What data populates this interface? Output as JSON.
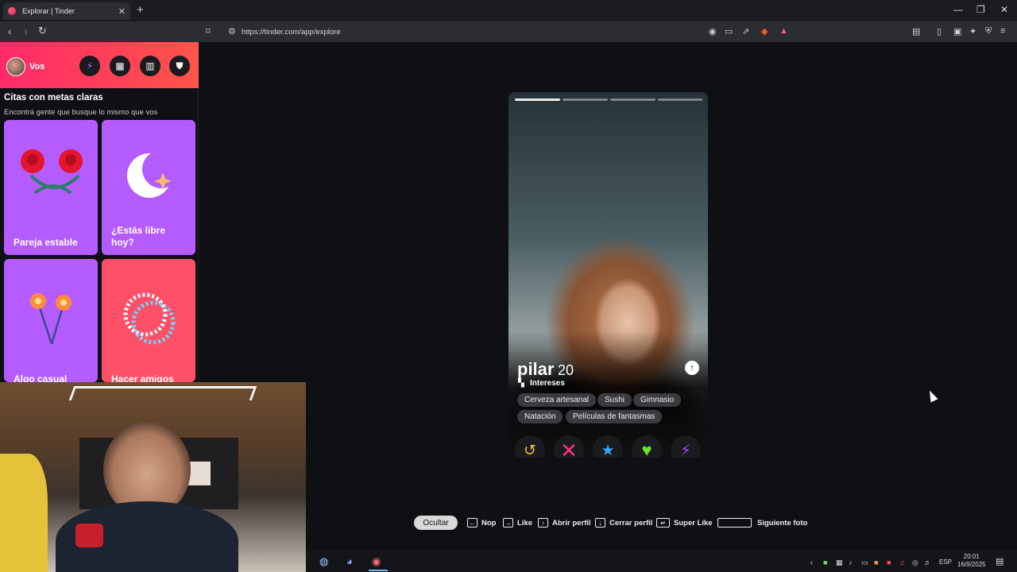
{
  "browser": {
    "tab_title": "Explorar | Tinder",
    "url": "https://tinder.com/app/explore",
    "new_tab": "+",
    "close": "✕"
  },
  "sidebar": {
    "user_label": "Vos",
    "section_title": "Citas con metas claras",
    "section_subtitle": "Encontrá gente que busque lo mismo que vos",
    "cards": [
      {
        "label": "Pareja estable",
        "bg": "#b45cff"
      },
      {
        "label": "¿Estás libre hoy?",
        "bg": "#b45cff"
      },
      {
        "label": "Algo casual",
        "bg": "#b45cff"
      },
      {
        "label": "Hacer amigos",
        "bg": "#ff5067"
      }
    ]
  },
  "profile": {
    "name": "pilar",
    "age": "20",
    "interests_label": "Intereses",
    "interests": [
      "Cerveza artesanal",
      "Sushi",
      "Gimnasio",
      "Natación",
      "Películas de fantasmas"
    ],
    "photo_count": 4,
    "active_photo": 1
  },
  "actions": {
    "rewind_color": "#f5b748",
    "nope_color": "#ff4458",
    "superlike_color": "#3ca4ff",
    "like_color": "#3ce68b",
    "boost_color": "#a24cff"
  },
  "hints": {
    "hide": "Ocultar",
    "nope": "Nop",
    "like": "Like",
    "open_profile": "Abrir perfil",
    "close_profile": "Cerrar perfil",
    "super_like": "Super Like",
    "next_photo": "Siguiente foto"
  },
  "taskbar": {
    "language": "ESP",
    "time": "20:01",
    "date": "16/9/2025"
  },
  "colors": {
    "brand_start": "#fd2a6b",
    "brand_end": "#ff5448"
  }
}
